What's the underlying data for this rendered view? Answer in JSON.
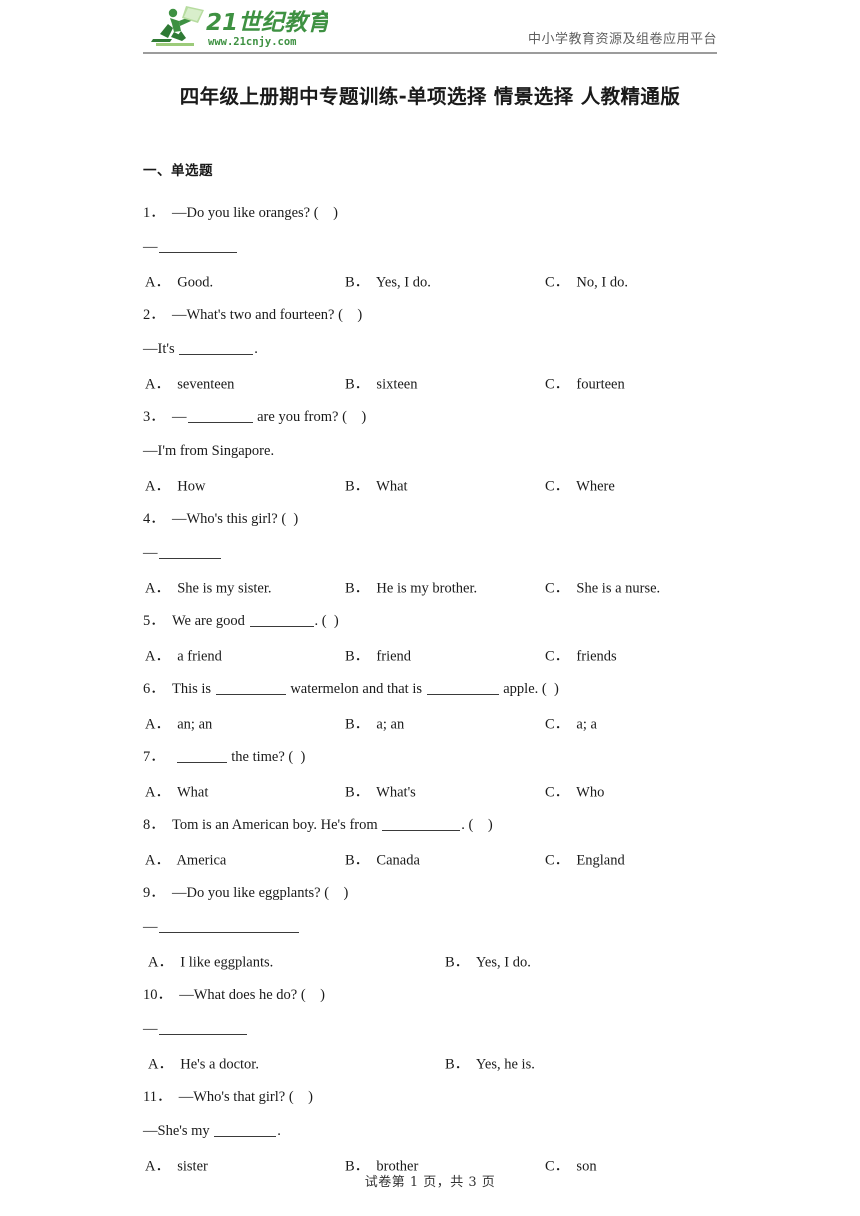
{
  "header": {
    "logo_text_main": "21世纪教育",
    "logo_text_url": "www.21cnjy.com",
    "tagline": "中小学教育资源及组卷应用平台",
    "logo_color": "#3e9142",
    "logo_dark_green": "#2f7a35"
  },
  "title": "四年级上册期中专题训练-单项选择 情景选择 人教精通版",
  "section": {
    "heading": "一、单选题"
  },
  "questions": [
    {
      "num": "1．",
      "stem": "—Do you like oranges? (    )",
      "answer_prefix": "—",
      "answer_suffix": "",
      "blank_width": 78,
      "options": [
        {
          "label": "A．",
          "text": "Good."
        },
        {
          "label": "B．",
          "text": "Yes, I do."
        },
        {
          "label": "C．",
          "text": "No, I do."
        }
      ]
    },
    {
      "num": "2．",
      "stem": "—What's two and fourteen? (    )",
      "answer_prefix": "—It's ",
      "answer_suffix": ".",
      "blank_width": 74,
      "options": [
        {
          "label": "A．",
          "text": "seventeen"
        },
        {
          "label": "B．",
          "text": "sixteen"
        },
        {
          "label": "C．",
          "text": "fourteen"
        }
      ]
    },
    {
      "num": "3．",
      "stem_prefix": "—",
      "stem_blank": 65,
      "stem_suffix": " are you from? (    )",
      "answer_prefix": "—I'm from Singapore.",
      "answer_suffix": "",
      "blank_width": 0,
      "options": [
        {
          "label": "A．",
          "text": "How"
        },
        {
          "label": "B．",
          "text": "What"
        },
        {
          "label": "C．",
          "text": "Where"
        }
      ]
    },
    {
      "num": "4．",
      "stem": "—Who's this girl? (  )",
      "answer_prefix": "—",
      "answer_suffix": "",
      "blank_width": 62,
      "options": [
        {
          "label": "A．",
          "text": "She is my sister."
        },
        {
          "label": "B．",
          "text": "He is my brother."
        },
        {
          "label": "C．",
          "text": "She is a nurse."
        }
      ]
    },
    {
      "num": "5．",
      "stem_prefix": "We are good ",
      "stem_blank": 64,
      "stem_suffix": ". (  )",
      "options": [
        {
          "label": "A．",
          "text": "a friend"
        },
        {
          "label": "B．",
          "text": "friend"
        },
        {
          "label": "C．",
          "text": "friends"
        }
      ]
    },
    {
      "num": "6．",
      "stem_prefix": "This is ",
      "stem_blank": 70,
      "stem_mid": " watermelon and that is ",
      "stem_blank2": 72,
      "stem_suffix": " apple. (  )",
      "options": [
        {
          "label": "A．",
          "text": "an; an"
        },
        {
          "label": "B．",
          "text": "a; an"
        },
        {
          "label": "C．",
          "text": "a; a"
        }
      ]
    },
    {
      "num": "7．",
      "stem_prefix": " ",
      "stem_blank": 50,
      "stem_suffix": " the time? (  )",
      "options": [
        {
          "label": "A．",
          "text": "What"
        },
        {
          "label": "B．",
          "text": "What's"
        },
        {
          "label": "C．",
          "text": "Who"
        }
      ]
    },
    {
      "num": "8．",
      "stem_prefix": "Tom is an American boy. He's from ",
      "stem_blank": 78,
      "stem_suffix": ". (    )",
      "options": [
        {
          "label": "A．",
          "text": "America"
        },
        {
          "label": "B．",
          "text": "Canada"
        },
        {
          "label": "C．",
          "text": "England"
        }
      ]
    },
    {
      "num": "9．",
      "stem": "—Do you like eggplants? (    )",
      "answer_prefix": "—",
      "answer_suffix": "",
      "blank_width": 140,
      "two_col": true,
      "options": [
        {
          "label": "A．",
          "text": "I like eggplants."
        },
        {
          "label": "B．",
          "text": "Yes, I do."
        }
      ]
    },
    {
      "num": "10．",
      "stem": "—What does he do? (    )",
      "answer_prefix": "—",
      "answer_suffix": "",
      "blank_width": 88,
      "two_col": true,
      "options": [
        {
          "label": "A．",
          "text": "He's a doctor."
        },
        {
          "label": "B．",
          "text": "Yes, he is."
        }
      ]
    },
    {
      "num": "11．",
      "stem": "—Who's that girl? (    )",
      "answer_prefix": "—She's my ",
      "answer_suffix": ".",
      "blank_width": 62,
      "options": [
        {
          "label": "A．",
          "text": "sister"
        },
        {
          "label": "B．",
          "text": "brother"
        },
        {
          "label": "C．",
          "text": "son"
        }
      ]
    }
  ],
  "footer": "试卷第 1 页，共 3 页"
}
